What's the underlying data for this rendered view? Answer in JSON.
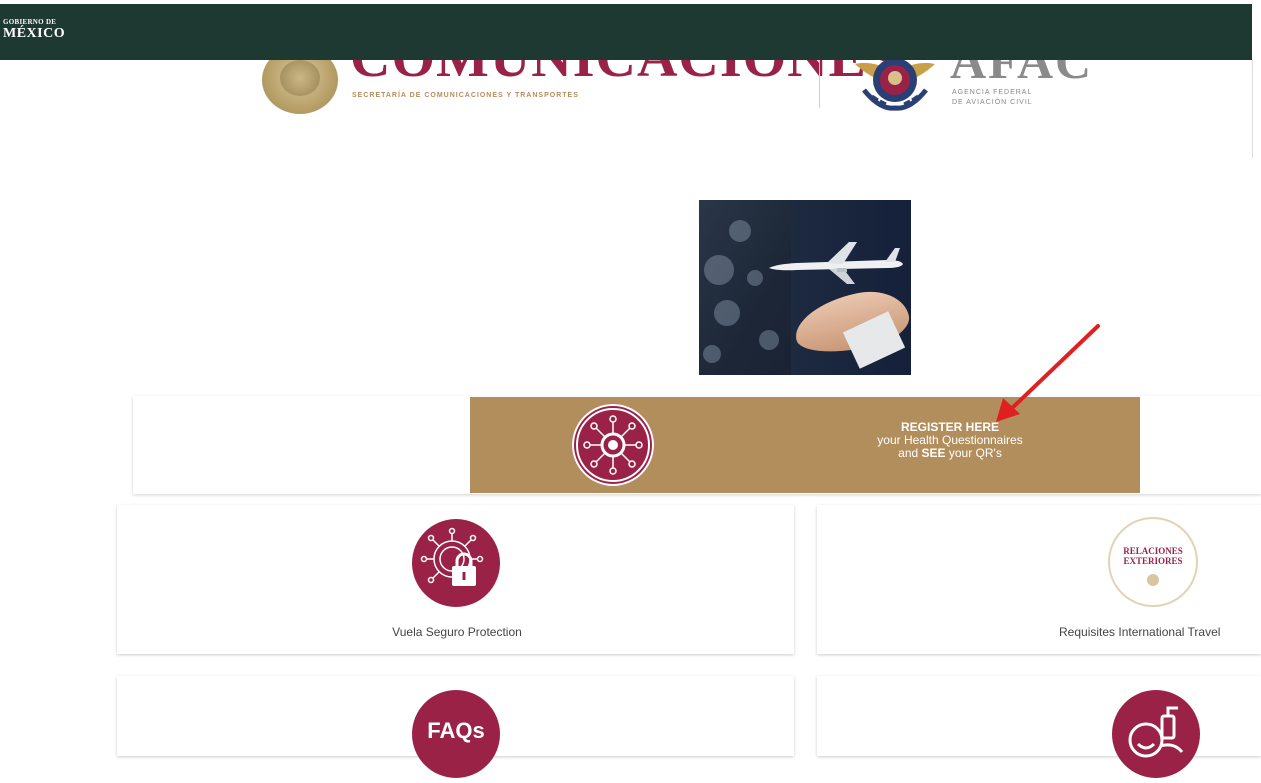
{
  "gov_bar": {
    "line1": "GOBIERNO DE",
    "line2": "MÉXICO",
    "bg_color": "#1e3832"
  },
  "header": {
    "sct_title": "COMUNICACIONES",
    "sct_subtitle": "SECRETARÍA DE COMUNICACIONES Y TRANSPORTES",
    "afac_title": "AFAC",
    "afac_subtitle_1": "AGENCIA FEDERAL",
    "afac_subtitle_2": "DE AVIACIÓN CIVIL"
  },
  "hero": {
    "icon": "hand-airplane-photo"
  },
  "register": {
    "title": "REGISTER HERE",
    "line2": "your Health Questionnaires",
    "line3_prefix": "and ",
    "line3_strong": "SEE",
    "line3_suffix": " your QR's",
    "icon": "virus-icon",
    "bg_color": "#b38e5d"
  },
  "cards": [
    {
      "label": "Vuela Seguro Protection",
      "icon": "virus-lock-icon"
    },
    {
      "label": "Requisites International Travel",
      "icon": "relaciones-exteriores-logo",
      "logo_line1": "RELACIONES",
      "logo_line2": "EXTERIORES"
    },
    {
      "label": "",
      "icon": "faqs-icon",
      "icon_text": "FAQs"
    },
    {
      "label": "",
      "icon": "sanitizer-hands-icon"
    }
  ],
  "colors": {
    "accent": "#9b2247",
    "gold": "#b38e5d",
    "annotation": "#e02020"
  }
}
